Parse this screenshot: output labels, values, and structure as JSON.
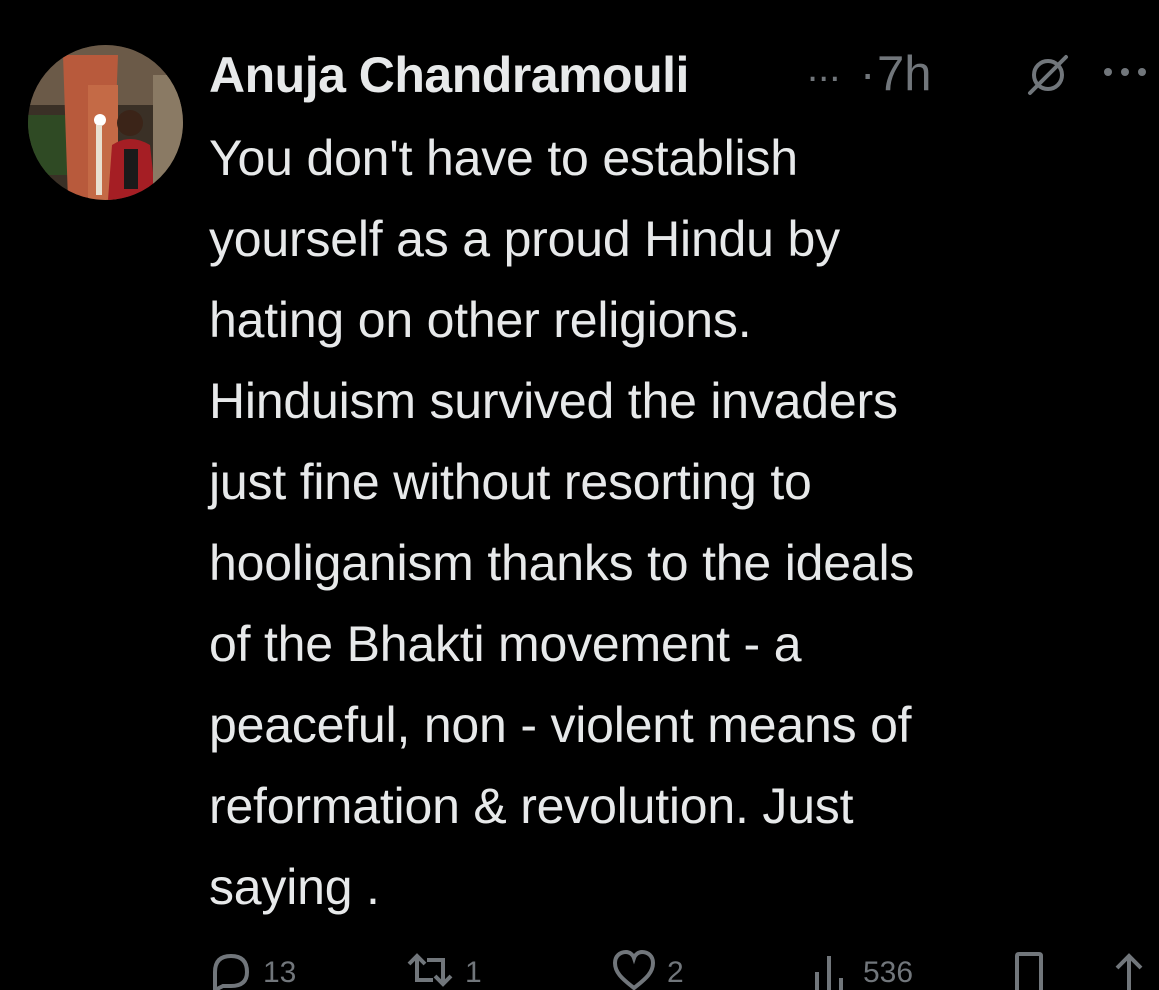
{
  "tweet": {
    "author": {
      "name": "Anuja Chandramouli",
      "avatar_icon": "user-avatar-photo"
    },
    "name_truncation": "...",
    "separator": "·",
    "timestamp": "7h",
    "header_icons": [
      "grok-icon",
      "more-icon"
    ],
    "text_lines": [
      "You don't have to establish",
      "yourself as a proud Hindu by",
      "hating on other religions.",
      "Hinduism survived the invaders",
      "just fine without resorting to",
      "hooliganism thanks to the ideals",
      "of the Bhakti movement - a",
      "peaceful, non - violent means of",
      "reformation & revolution. Just",
      "saying ."
    ],
    "actions": {
      "replies": "13",
      "reposts": "1",
      "likes": "2",
      "views": "536",
      "icons": [
        "reply-icon",
        "repost-icon",
        "like-icon",
        "views-icon",
        "bookmark-icon",
        "share-icon"
      ]
    }
  },
  "colors": {
    "background": "#000000",
    "text_primary": "#e7e9ea",
    "text_secondary": "#71767b"
  }
}
